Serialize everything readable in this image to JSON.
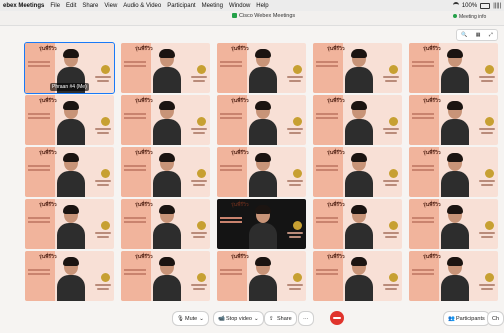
{
  "menubar": {
    "app": "ebex Meetings",
    "items": [
      "File",
      "Edit",
      "Share",
      "View",
      "Audio & Video",
      "Participant",
      "Meeting",
      "Window",
      "Help"
    ],
    "battery": "100%",
    "status_extra": "|||||"
  },
  "window": {
    "title": "Cisco Webex Meetings",
    "meeting_info": "Meeting info",
    "zoom_icon_label": "🔍"
  },
  "tile_logo": "รุ่นพี่รีวิว",
  "active_speaker": {
    "name": "Phraan #4",
    "status": "(Me)"
  },
  "controls": {
    "mute": "Mute",
    "stop_video": "Stop video",
    "share": "Share",
    "participants": "Participants",
    "chat": "Ch"
  },
  "colors": {
    "accent": "#1a7af7",
    "end": "#e0342d",
    "secure": "#24a148",
    "tile_bg": "#f8e0d6"
  }
}
